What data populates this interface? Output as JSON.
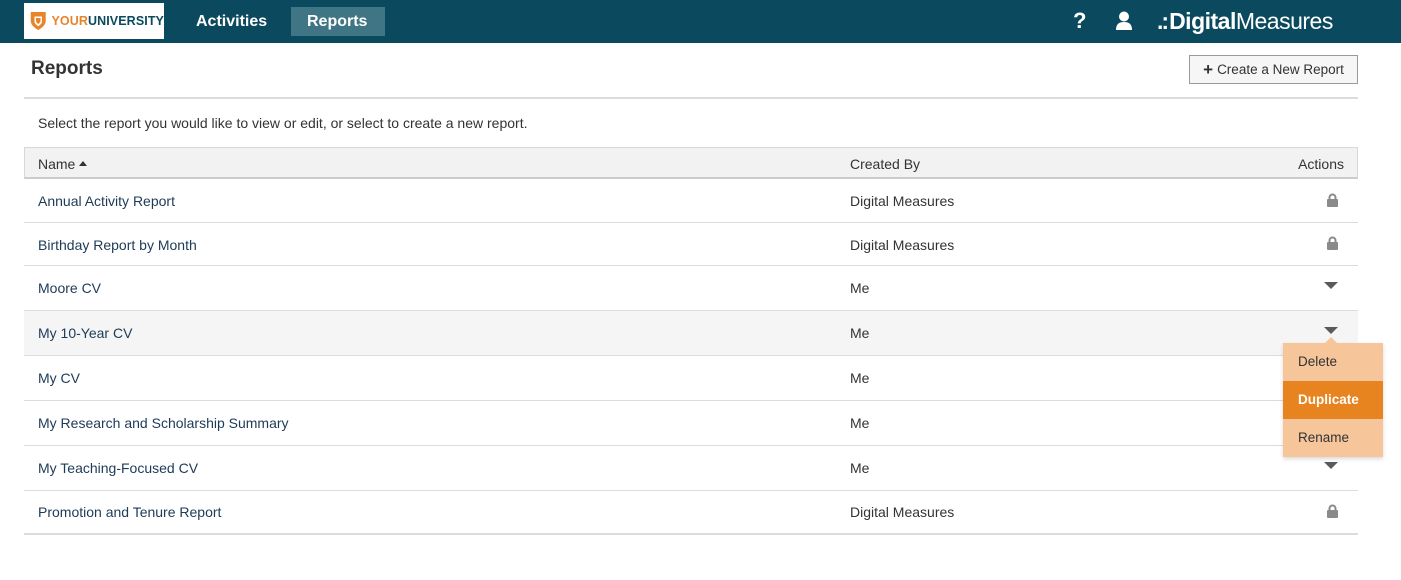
{
  "header": {
    "logo_your": "YOUR",
    "logo_university": "UNIVERSITY",
    "nav": [
      {
        "label": "Activities"
      },
      {
        "label": "Reports"
      }
    ],
    "help_label": "?",
    "brand_dots": ".:",
    "brand_bold": "Digital",
    "brand_light": "Measures"
  },
  "page": {
    "title": "Reports",
    "create_button": "Create a New Report",
    "intro": "Select the report you would like to view or edit, or select to create a new report."
  },
  "table": {
    "columns": {
      "name": "Name",
      "created_by": "Created By",
      "actions": "Actions"
    },
    "rows": [
      {
        "name": "Annual Activity Report",
        "created_by": "Digital Measures",
        "action": "lock-icon"
      },
      {
        "name": "Birthday Report by Month",
        "created_by": "Digital Measures",
        "action": "lock-icon"
      },
      {
        "name": "Moore CV",
        "created_by": "Me",
        "action": "menu-caret-icon"
      },
      {
        "name": "My 10-Year CV",
        "created_by": "Me",
        "action": "menu-caret-icon"
      },
      {
        "name": "My CV",
        "created_by": "Me",
        "action": "menu-caret-icon"
      },
      {
        "name": "My Research and Scholarship Summary",
        "created_by": "Me",
        "action": "menu-caret-icon"
      },
      {
        "name": "My Teaching-Focused CV",
        "created_by": "Me",
        "action": "menu-caret-icon"
      },
      {
        "name": "Promotion and Tenure Report",
        "created_by": "Digital Measures",
        "action": "lock-icon"
      }
    ]
  },
  "action_menu": {
    "items": [
      {
        "label": "Delete"
      },
      {
        "label": "Duplicate"
      },
      {
        "label": "Rename"
      }
    ],
    "highlighted": "Duplicate"
  },
  "colors": {
    "topbar": "#0b4a5e",
    "nav_active": "#3f7584",
    "link": "#1d3a57",
    "menu_bg": "#f6c59a",
    "menu_active": "#e8841f"
  }
}
